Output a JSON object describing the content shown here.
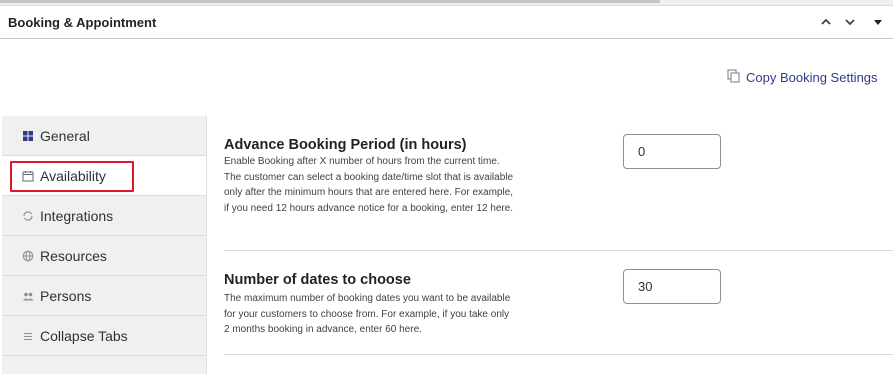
{
  "panel": {
    "title": "Booking & Appointment",
    "collapse_up_icon": "chevron-up-icon",
    "collapse_down_icon": "chevron-down-icon",
    "toggle_icon": "caret-down-icon"
  },
  "copy_settings": {
    "label": "Copy Booking Settings",
    "icon": "copy-icon"
  },
  "sidebar": {
    "items": [
      {
        "label": "General",
        "icon": "grid-icon"
      },
      {
        "label": "Availability",
        "icon": "calendar-icon",
        "active": true
      },
      {
        "label": "Integrations",
        "icon": "sync-icon"
      },
      {
        "label": "Resources",
        "icon": "globe-icon"
      },
      {
        "label": "Persons",
        "icon": "people-icon"
      },
      {
        "label": "Collapse Tabs",
        "icon": "menu-icon"
      }
    ]
  },
  "settings": [
    {
      "title": "Advance Booking Period (in hours)",
      "description": "Enable Booking after X number of hours from the current time. The customer can select a booking date/time slot that is available only after the minimum hours that are entered here. For example, if you need 12 hours advance notice for a booking, enter 12 here.",
      "value": "0"
    },
    {
      "title": "Number of dates to choose",
      "description": "The maximum number of booking dates you want to be available for your customers to choose from. For example, if you take only 2 months booking in advance, enter 60 here.",
      "value": "30"
    }
  ],
  "colors": {
    "link": "#2f3b8e",
    "highlight": "#e0162b",
    "sidebar_bg": "#f0f0f0"
  }
}
